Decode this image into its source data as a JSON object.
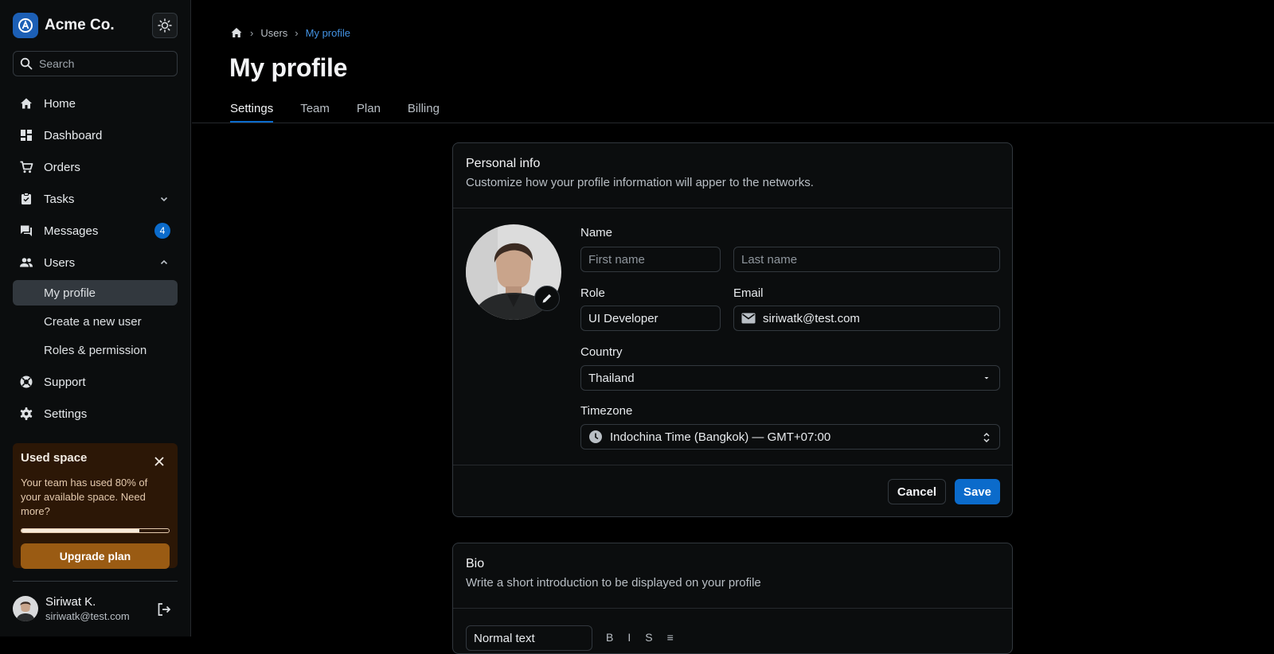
{
  "brand": {
    "name": "Acme Co."
  },
  "search": {
    "placeholder": "Search"
  },
  "sidebar": {
    "items": [
      {
        "label": "Home"
      },
      {
        "label": "Dashboard"
      },
      {
        "label": "Orders"
      },
      {
        "label": "Tasks"
      },
      {
        "label": "Messages",
        "badge": "4"
      },
      {
        "label": "Users"
      }
    ],
    "users_sub": [
      {
        "label": "My profile",
        "active": true
      },
      {
        "label": "Create a new user"
      },
      {
        "label": "Roles & permission"
      }
    ],
    "bottom_items": [
      {
        "label": "Support"
      },
      {
        "label": "Settings"
      }
    ]
  },
  "used_space": {
    "title": "Used space",
    "text": "Your team has used 80% of your available space. Need more?",
    "progress": 0.8,
    "button": "Upgrade plan"
  },
  "user": {
    "name": "Siriwat K.",
    "email": "siriwatk@test.com"
  },
  "breadcrumb": {
    "parent": "Users",
    "current": "My profile"
  },
  "page": {
    "title": "My profile"
  },
  "tabs": [
    {
      "label": "Settings",
      "active": true
    },
    {
      "label": "Team"
    },
    {
      "label": "Plan"
    },
    {
      "label": "Billing"
    }
  ],
  "personal": {
    "title": "Personal info",
    "subtitle": "Customize how your profile information will apper to the networks.",
    "name_label": "Name",
    "first_placeholder": "First name",
    "last_placeholder": "Last name",
    "role_label": "Role",
    "role_value": "UI Developer",
    "email_label": "Email",
    "email_value": "siriwatk@test.com",
    "country_label": "Country",
    "country_value": "Thailand",
    "timezone_label": "Timezone",
    "timezone_value": "Indochina Time (Bangkok) — GMT+07:00",
    "cancel": "Cancel",
    "save": "Save"
  },
  "bio": {
    "title": "Bio",
    "subtitle": "Write a short introduction to be displayed on your profile",
    "format_value": "Normal text",
    "tools": [
      "B",
      "I",
      "S",
      "≡"
    ]
  },
  "colors": {
    "accent": "#0b6bcb",
    "warning_bg": "#2c1706",
    "upgrade_btn": "#9a5b13"
  }
}
